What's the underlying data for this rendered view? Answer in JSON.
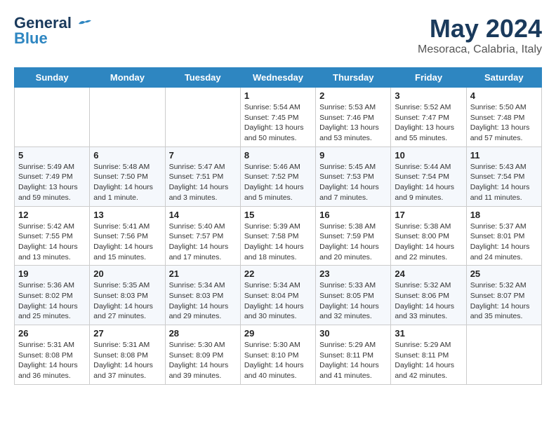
{
  "header": {
    "logo_line1": "General",
    "logo_line2": "Blue",
    "month_year": "May 2024",
    "location": "Mesoraca, Calabria, Italy"
  },
  "weekdays": [
    "Sunday",
    "Monday",
    "Tuesday",
    "Wednesday",
    "Thursday",
    "Friday",
    "Saturday"
  ],
  "weeks": [
    [
      {
        "day": "",
        "info": ""
      },
      {
        "day": "",
        "info": ""
      },
      {
        "day": "",
        "info": ""
      },
      {
        "day": "1",
        "info": "Sunrise: 5:54 AM\nSunset: 7:45 PM\nDaylight: 13 hours\nand 50 minutes."
      },
      {
        "day": "2",
        "info": "Sunrise: 5:53 AM\nSunset: 7:46 PM\nDaylight: 13 hours\nand 53 minutes."
      },
      {
        "day": "3",
        "info": "Sunrise: 5:52 AM\nSunset: 7:47 PM\nDaylight: 13 hours\nand 55 minutes."
      },
      {
        "day": "4",
        "info": "Sunrise: 5:50 AM\nSunset: 7:48 PM\nDaylight: 13 hours\nand 57 minutes."
      }
    ],
    [
      {
        "day": "5",
        "info": "Sunrise: 5:49 AM\nSunset: 7:49 PM\nDaylight: 13 hours\nand 59 minutes."
      },
      {
        "day": "6",
        "info": "Sunrise: 5:48 AM\nSunset: 7:50 PM\nDaylight: 14 hours\nand 1 minute."
      },
      {
        "day": "7",
        "info": "Sunrise: 5:47 AM\nSunset: 7:51 PM\nDaylight: 14 hours\nand 3 minutes."
      },
      {
        "day": "8",
        "info": "Sunrise: 5:46 AM\nSunset: 7:52 PM\nDaylight: 14 hours\nand 5 minutes."
      },
      {
        "day": "9",
        "info": "Sunrise: 5:45 AM\nSunset: 7:53 PM\nDaylight: 14 hours\nand 7 minutes."
      },
      {
        "day": "10",
        "info": "Sunrise: 5:44 AM\nSunset: 7:54 PM\nDaylight: 14 hours\nand 9 minutes."
      },
      {
        "day": "11",
        "info": "Sunrise: 5:43 AM\nSunset: 7:54 PM\nDaylight: 14 hours\nand 11 minutes."
      }
    ],
    [
      {
        "day": "12",
        "info": "Sunrise: 5:42 AM\nSunset: 7:55 PM\nDaylight: 14 hours\nand 13 minutes."
      },
      {
        "day": "13",
        "info": "Sunrise: 5:41 AM\nSunset: 7:56 PM\nDaylight: 14 hours\nand 15 minutes."
      },
      {
        "day": "14",
        "info": "Sunrise: 5:40 AM\nSunset: 7:57 PM\nDaylight: 14 hours\nand 17 minutes."
      },
      {
        "day": "15",
        "info": "Sunrise: 5:39 AM\nSunset: 7:58 PM\nDaylight: 14 hours\nand 18 minutes."
      },
      {
        "day": "16",
        "info": "Sunrise: 5:38 AM\nSunset: 7:59 PM\nDaylight: 14 hours\nand 20 minutes."
      },
      {
        "day": "17",
        "info": "Sunrise: 5:38 AM\nSunset: 8:00 PM\nDaylight: 14 hours\nand 22 minutes."
      },
      {
        "day": "18",
        "info": "Sunrise: 5:37 AM\nSunset: 8:01 PM\nDaylight: 14 hours\nand 24 minutes."
      }
    ],
    [
      {
        "day": "19",
        "info": "Sunrise: 5:36 AM\nSunset: 8:02 PM\nDaylight: 14 hours\nand 25 minutes."
      },
      {
        "day": "20",
        "info": "Sunrise: 5:35 AM\nSunset: 8:03 PM\nDaylight: 14 hours\nand 27 minutes."
      },
      {
        "day": "21",
        "info": "Sunrise: 5:34 AM\nSunset: 8:03 PM\nDaylight: 14 hours\nand 29 minutes."
      },
      {
        "day": "22",
        "info": "Sunrise: 5:34 AM\nSunset: 8:04 PM\nDaylight: 14 hours\nand 30 minutes."
      },
      {
        "day": "23",
        "info": "Sunrise: 5:33 AM\nSunset: 8:05 PM\nDaylight: 14 hours\nand 32 minutes."
      },
      {
        "day": "24",
        "info": "Sunrise: 5:32 AM\nSunset: 8:06 PM\nDaylight: 14 hours\nand 33 minutes."
      },
      {
        "day": "25",
        "info": "Sunrise: 5:32 AM\nSunset: 8:07 PM\nDaylight: 14 hours\nand 35 minutes."
      }
    ],
    [
      {
        "day": "26",
        "info": "Sunrise: 5:31 AM\nSunset: 8:08 PM\nDaylight: 14 hours\nand 36 minutes."
      },
      {
        "day": "27",
        "info": "Sunrise: 5:31 AM\nSunset: 8:08 PM\nDaylight: 14 hours\nand 37 minutes."
      },
      {
        "day": "28",
        "info": "Sunrise: 5:30 AM\nSunset: 8:09 PM\nDaylight: 14 hours\nand 39 minutes."
      },
      {
        "day": "29",
        "info": "Sunrise: 5:30 AM\nSunset: 8:10 PM\nDaylight: 14 hours\nand 40 minutes."
      },
      {
        "day": "30",
        "info": "Sunrise: 5:29 AM\nSunset: 8:11 PM\nDaylight: 14 hours\nand 41 minutes."
      },
      {
        "day": "31",
        "info": "Sunrise: 5:29 AM\nSunset: 8:11 PM\nDaylight: 14 hours\nand 42 minutes."
      },
      {
        "day": "",
        "info": ""
      }
    ]
  ]
}
